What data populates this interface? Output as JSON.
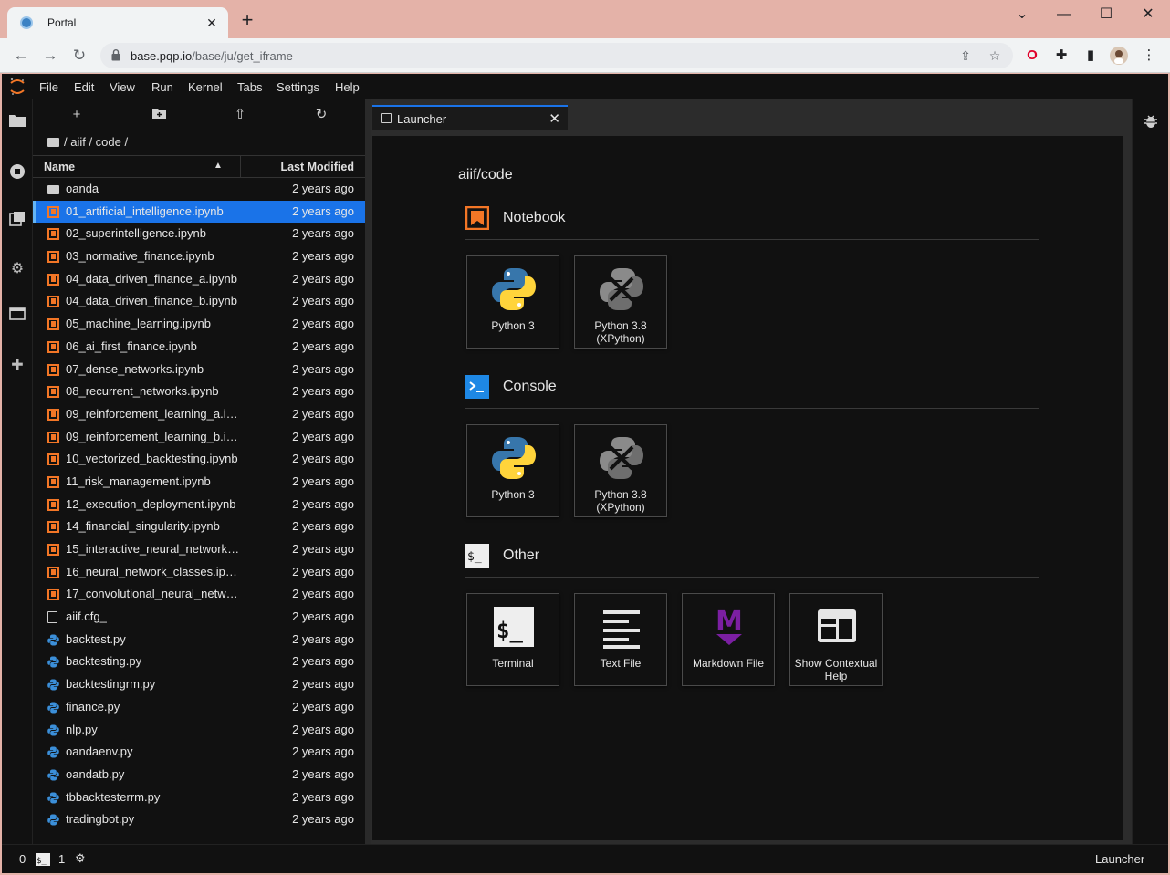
{
  "browser": {
    "tab_title": "Portal",
    "url_host": "base.pqp.io",
    "url_path": "/base/ju/get_iframe"
  },
  "menu": [
    "File",
    "Edit",
    "View",
    "Run",
    "Kernel",
    "Tabs",
    "Settings",
    "Help"
  ],
  "filebrowser": {
    "breadcrumb": "/ aiif / code /",
    "col_name": "Name",
    "col_modified": "Last Modified",
    "files": [
      {
        "name": "oanda",
        "type": "folder",
        "modified": "2 years ago"
      },
      {
        "name": "01_artificial_intelligence.ipynb",
        "type": "notebook",
        "modified": "2 years ago",
        "selected": true
      },
      {
        "name": "02_superintelligence.ipynb",
        "type": "notebook",
        "modified": "2 years ago"
      },
      {
        "name": "03_normative_finance.ipynb",
        "type": "notebook",
        "modified": "2 years ago"
      },
      {
        "name": "04_data_driven_finance_a.ipynb",
        "type": "notebook",
        "modified": "2 years ago"
      },
      {
        "name": "04_data_driven_finance_b.ipynb",
        "type": "notebook",
        "modified": "2 years ago"
      },
      {
        "name": "05_machine_learning.ipynb",
        "type": "notebook",
        "modified": "2 years ago"
      },
      {
        "name": "06_ai_first_finance.ipynb",
        "type": "notebook",
        "modified": "2 years ago"
      },
      {
        "name": "07_dense_networks.ipynb",
        "type": "notebook",
        "modified": "2 years ago"
      },
      {
        "name": "08_recurrent_networks.ipynb",
        "type": "notebook",
        "modified": "2 years ago"
      },
      {
        "name": "09_reinforcement_learning_a.ip...",
        "type": "notebook",
        "modified": "2 years ago"
      },
      {
        "name": "09_reinforcement_learning_b.ip...",
        "type": "notebook",
        "modified": "2 years ago"
      },
      {
        "name": "10_vectorized_backtesting.ipynb",
        "type": "notebook",
        "modified": "2 years ago"
      },
      {
        "name": "11_risk_management.ipynb",
        "type": "notebook",
        "modified": "2 years ago"
      },
      {
        "name": "12_execution_deployment.ipynb",
        "type": "notebook",
        "modified": "2 years ago"
      },
      {
        "name": "14_financial_singularity.ipynb",
        "type": "notebook",
        "modified": "2 years ago"
      },
      {
        "name": "15_interactive_neural_networks....",
        "type": "notebook",
        "modified": "2 years ago"
      },
      {
        "name": "16_neural_network_classes.ipynb",
        "type": "notebook",
        "modified": "2 years ago"
      },
      {
        "name": "17_convolutional_neural_netwo...",
        "type": "notebook",
        "modified": "2 years ago"
      },
      {
        "name": "aiif.cfg_",
        "type": "file",
        "modified": "2 years ago"
      },
      {
        "name": "backtest.py",
        "type": "python",
        "modified": "2 years ago"
      },
      {
        "name": "backtesting.py",
        "type": "python",
        "modified": "2 years ago"
      },
      {
        "name": "backtestingrm.py",
        "type": "python",
        "modified": "2 years ago"
      },
      {
        "name": "finance.py",
        "type": "python",
        "modified": "2 years ago"
      },
      {
        "name": "nlp.py",
        "type": "python",
        "modified": "2 years ago"
      },
      {
        "name": "oandaenv.py",
        "type": "python",
        "modified": "2 years ago"
      },
      {
        "name": "oandatb.py",
        "type": "python",
        "modified": "2 years ago"
      },
      {
        "name": "tbbacktesterrm.py",
        "type": "python",
        "modified": "2 years ago"
      },
      {
        "name": "tradingbot.py",
        "type": "python",
        "modified": "2 years ago"
      }
    ]
  },
  "launcher": {
    "tab_label": "Launcher",
    "cwd": "aiif/code",
    "sections": {
      "notebook": {
        "title": "Notebook",
        "cards": [
          "Python 3",
          "Python 3.8\n(XPython)"
        ]
      },
      "console": {
        "title": "Console",
        "cards": [
          "Python 3",
          "Python 3.8\n(XPython)"
        ]
      },
      "other": {
        "title": "Other",
        "cards": [
          "Terminal",
          "Text File",
          "Markdown File",
          "Show Contextual\nHelp"
        ]
      }
    }
  },
  "statusbar": {
    "left_count1": "0",
    "left_count2": "1",
    "right_label": "Launcher"
  },
  "colors": {
    "accent": "#1a73e8",
    "notebook": "#f37626",
    "console": "#1e88e5",
    "markdown": "#7b1fa2"
  }
}
